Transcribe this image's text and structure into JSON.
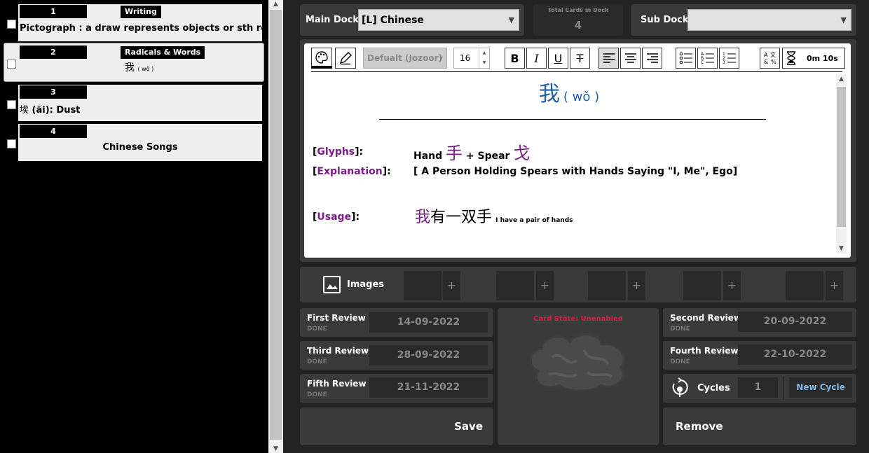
{
  "cards": [
    {
      "num": "1",
      "tag": "Writing",
      "text": "Pictograph : a draw represents objects or sth real;  eg:"
    },
    {
      "num": "2",
      "tag": "Radicals & Words",
      "char": "我",
      "pinyin": "( wǒ )"
    },
    {
      "num": "3",
      "text_char": "埃",
      "text_pinyin": "(āi)",
      "text_rest": ": Dust"
    },
    {
      "num": "4",
      "text": "Chinese Songs"
    }
  ],
  "top": {
    "main_dock_label": "Main Dock",
    "main_dock_value": "[L] Chinese",
    "total_cards_label": "Total Cards in Dock",
    "total_cards_value": "4",
    "sub_dock_label": "Sub Dock",
    "sub_dock_value": ""
  },
  "toolbar": {
    "font_name": "Defualt (Jozoor)",
    "font_size": "16",
    "bold": "B",
    "italic": "I",
    "underline": "U",
    "strike": "T",
    "timer": "0m 10s"
  },
  "editor": {
    "title_char": "我",
    "title_pinyin": "( wǒ )",
    "glyphs_label": "Glyphs",
    "glyphs_hand": "Hand",
    "glyphs_hand_char": "手",
    "glyphs_plus": "+ Spear",
    "glyphs_spear_char": "戈",
    "explanation_label": "Explanation",
    "explanation_value": "[ A Person Holding Spears with Hands Saying \"I, Me\", Ego]",
    "usage_label": "Usage",
    "usage_char1": "我",
    "usage_rest": "有一双手",
    "usage_en": "I have a pair of hands"
  },
  "images": {
    "label": "Images",
    "plus": "+"
  },
  "reviews": {
    "done": "DONE",
    "first": {
      "title": "First Review",
      "date": "14-09-2022"
    },
    "second": {
      "title": "Second Review",
      "date": "20-09-2022"
    },
    "third": {
      "title": "Third Review",
      "date": "28-09-2022"
    },
    "fourth": {
      "title": "Fourth Review",
      "date": "22-10-2022"
    },
    "fifth": {
      "title": "Fifth Review",
      "date": "21-11-2022"
    }
  },
  "card_state": "Card State: Unenabled",
  "cycles": {
    "label": "Cycles",
    "value": "1",
    "new_cycle": "New Cycle"
  },
  "actions": {
    "save": "Save",
    "remove": "Remove"
  },
  "colors": {
    "accent_red": "#e8174a",
    "purple": "#7b1c8a",
    "blue": "#1f5fa8",
    "new_cycle": "#7fb6e8"
  },
  "icons": [
    "palette-icon",
    "pen-icon",
    "list-bullet-icon",
    "list-alpha-icon",
    "list-number-icon",
    "spellcheck-icon",
    "hourglass-icon",
    "image-icon",
    "cycle-icon",
    "brain-icon"
  ]
}
